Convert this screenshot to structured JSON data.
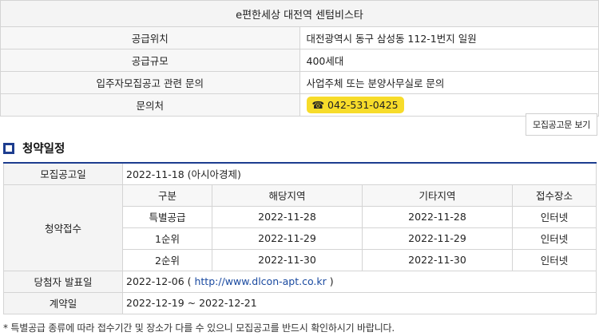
{
  "info": {
    "title": "e편한세상 대전역 센텀비스타",
    "rows": [
      {
        "label": "공급위치",
        "value": "대전광역시 동구 삼성동 112-1번지 일원"
      },
      {
        "label": "공급규모",
        "value": "400세대"
      },
      {
        "label": "입주자모집공고 관련 문의",
        "value": "사업주체 또는 분양사무실로 문의"
      },
      {
        "label": "문의처",
        "value": "☎ 042-531-0425"
      }
    ]
  },
  "notice_button": "모집공고문 보기",
  "section_title": "청약일정",
  "schedule": {
    "announce_label": "모집공고일",
    "announce_value": "2022-11-18 (아시아경제)",
    "reception_label": "청약접수",
    "sub_headers": [
      "구분",
      "해당지역",
      "기타지역",
      "접수장소"
    ],
    "sub_rows": [
      [
        "특별공급",
        "2022-11-28",
        "2022-11-28",
        "인터넷"
      ],
      [
        "1순위",
        "2022-11-29",
        "2022-11-29",
        "인터넷"
      ],
      [
        "2순위",
        "2022-11-30",
        "2022-11-30",
        "인터넷"
      ]
    ],
    "winner_label": "당첨자 발표일",
    "winner_date": "2022-12-06",
    "winner_paren_open": " ( ",
    "winner_link": "http://www.dlcon-apt.co.kr",
    "winner_paren_close": " )",
    "contract_label": "계약일",
    "contract_value": "2022-12-19 ~ 2022-12-21"
  },
  "footnote": "* 특별공급 종류에 따라 접수기간 및 장소가 다를 수 있으니 모집공고를 반드시 확인하시기 바랍니다.",
  "colors": {
    "accent": "#1d3d8f",
    "phone_bg": "#f7dc2a"
  },
  "icons": {
    "section": "square-bullet-icon",
    "phone": "phone-icon"
  }
}
